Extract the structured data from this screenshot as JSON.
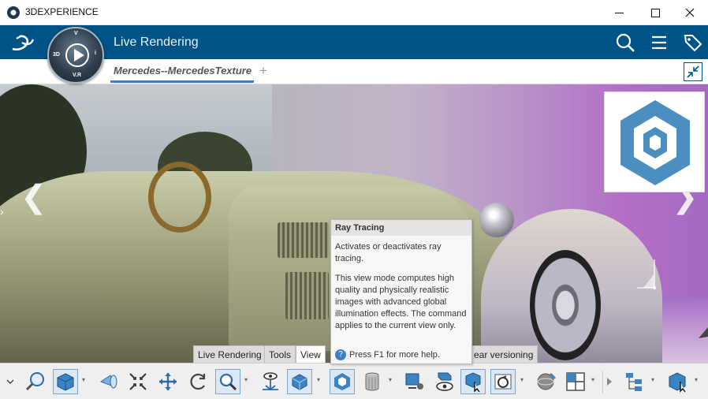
{
  "window": {
    "title": "3DEXPERIENCE"
  },
  "header": {
    "app_name": "Live Rendering",
    "compass": {
      "top_letter": "V",
      "left_label": "3D",
      "right_label": "i",
      "bottom_label": "V.R"
    }
  },
  "tabs": {
    "items": [
      {
        "label": "Mercedes--MercedesTexture"
      }
    ],
    "add_label": "+"
  },
  "tooltip": {
    "title": "Ray Tracing",
    "paragraph_1": "Activates or deactivates ray tracing.",
    "paragraph_2": "This view mode computes high quality and physically realistic images with advanced global illumination effects. The command applies to the current view only.",
    "help": "Press F1 for more help."
  },
  "action_bar_tabs": [
    {
      "label": "Live Rendering",
      "active": false
    },
    {
      "label": "Tools",
      "active": false
    },
    {
      "label": "View",
      "active": true
    },
    {
      "label": "ear versioning",
      "active": false
    }
  ],
  "toolbar": {
    "buttons": [
      "zoom-area-icon",
      "view-cube-icon",
      "view-mode-icon",
      "zoom-fit-icon",
      "pan-icon",
      "rotate-icon",
      "zoom-icon",
      "look-at-icon",
      "render-mode-icon",
      "ray-tracing-icon",
      "environment-icon",
      "camera-settings-icon",
      "visibility-icon",
      "select-icon",
      "animation-icon",
      "material-icon",
      "layout-icon",
      "tree-icon",
      "properties-icon"
    ]
  },
  "colors": {
    "header_blue": "#005386",
    "tab_accent": "#3a7fc4",
    "logo_blue": "#4a8fc0"
  }
}
